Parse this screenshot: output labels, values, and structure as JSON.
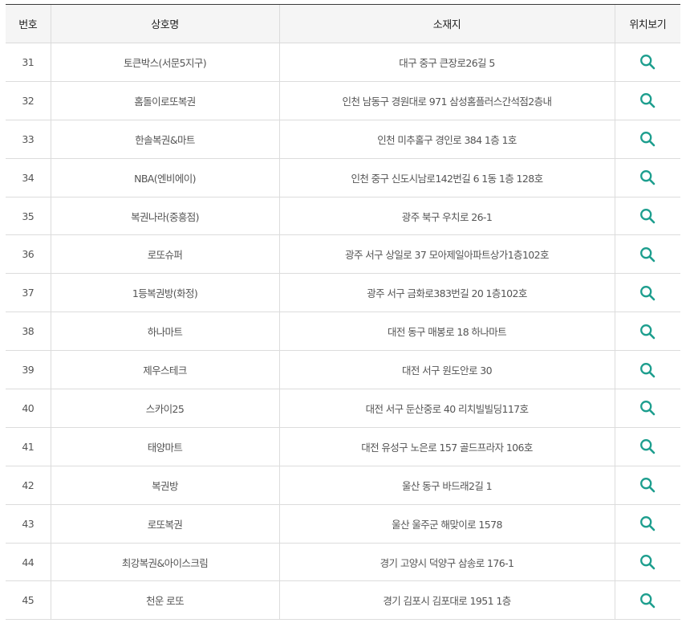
{
  "colors": {
    "accent": "#1d9e8e"
  },
  "table": {
    "headers": {
      "number": "번호",
      "name": "상호명",
      "address": "소재지",
      "location": "위치보기"
    },
    "location_icon": "search-icon",
    "rows": [
      {
        "number": "31",
        "name": "토큰박스(서문5지구)",
        "address": "대구 중구 큰장로26길 5"
      },
      {
        "number": "32",
        "name": "홈돌이로또복권",
        "address": "인천 남동구 경원대로 971 삼성홈플러스간석점2층내"
      },
      {
        "number": "33",
        "name": "한솔복권&마트",
        "address": "인천 미추홀구 경인로 384 1층 1호"
      },
      {
        "number": "34",
        "name": "NBA(엔비에이)",
        "address": "인천 중구 신도시남로142번길 6 1동 1층 128호"
      },
      {
        "number": "35",
        "name": "복권나라(중흥점)",
        "address": "광주 북구 우치로 26-1"
      },
      {
        "number": "36",
        "name": "로또슈퍼",
        "address": "광주 서구 상일로 37 모아제일아파트상가1층102호"
      },
      {
        "number": "37",
        "name": "1등복권방(화정)",
        "address": "광주 서구 금화로383번길 20 1층102호"
      },
      {
        "number": "38",
        "name": "하나마트",
        "address": "대전 동구 매봉로 18 하나마트"
      },
      {
        "number": "39",
        "name": "제우스테크",
        "address": "대전 서구 원도안로 30"
      },
      {
        "number": "40",
        "name": "스카이25",
        "address": "대전 서구 둔산중로 40 리치빌빌딩117호"
      },
      {
        "number": "41",
        "name": "태양마트",
        "address": "대전 유성구 노은로 157 골드프라자 106호"
      },
      {
        "number": "42",
        "name": "복권방",
        "address": "울산 동구 바드래2길 1"
      },
      {
        "number": "43",
        "name": "로또복권",
        "address": "울산 울주군 해맞이로 1578"
      },
      {
        "number": "44",
        "name": "최강복권&아이스크림",
        "address": "경기 고양시 덕양구 삼송로 176-1"
      },
      {
        "number": "45",
        "name": "천운 로또",
        "address": "경기 김포시 김포대로 1951 1층"
      }
    ]
  }
}
